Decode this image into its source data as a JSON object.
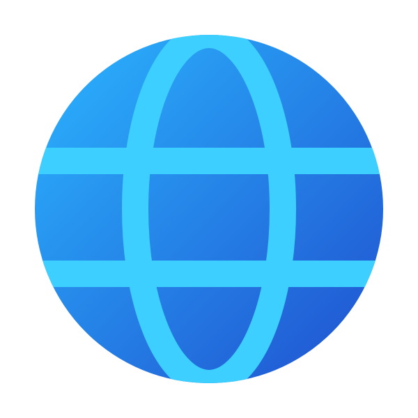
{
  "icon": {
    "name": "globe-icon",
    "colors": {
      "gradient_start": "#2BB6FF",
      "gradient_end": "#1F4FCF",
      "grid_lines": "#3DCFFF"
    }
  }
}
